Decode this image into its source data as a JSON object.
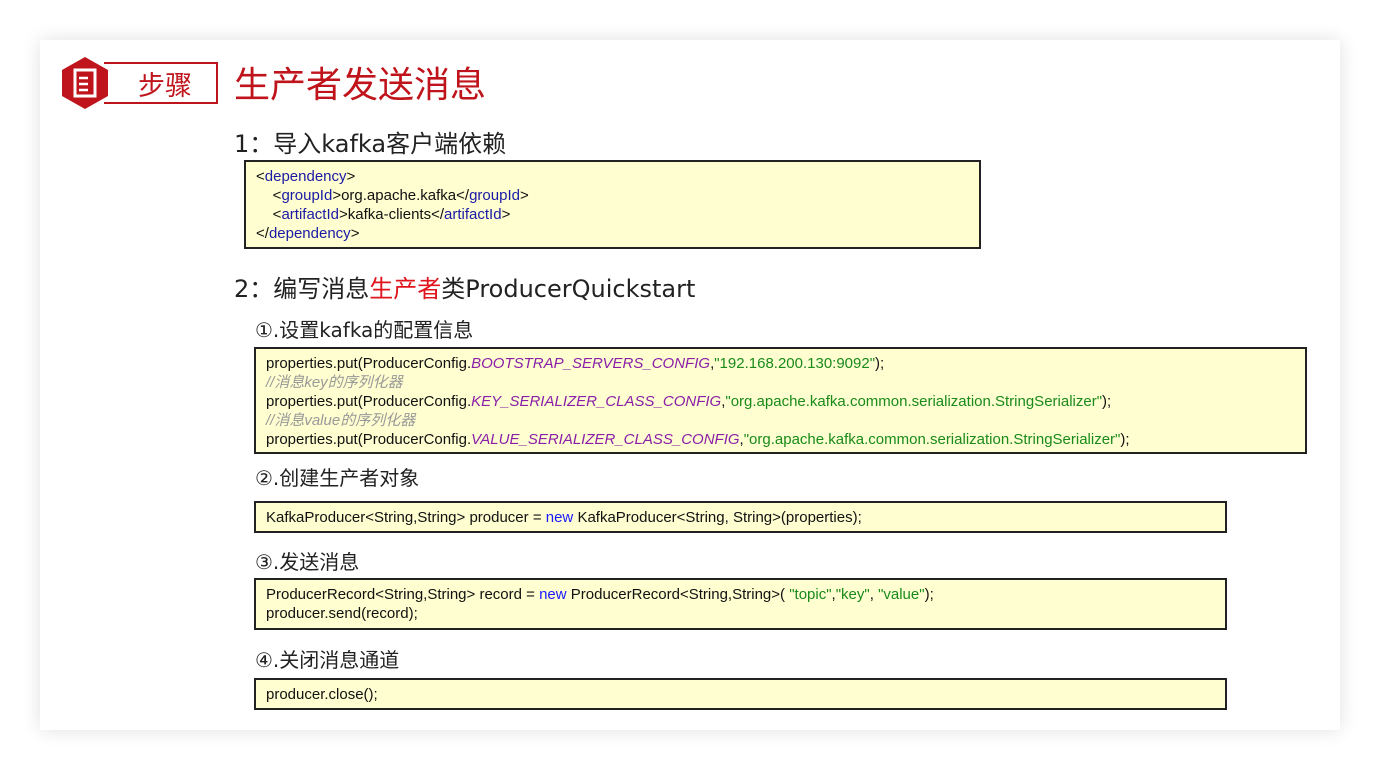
{
  "badge": {
    "label": "步骤",
    "icon": "document-icon",
    "color": "#c0141c"
  },
  "title": "生产者发送消息",
  "step1": {
    "heading": "1：导入kafka客户端依赖",
    "code": {
      "l1_open": "<",
      "l1_tag": "dependency",
      "l1_close": ">",
      "l2_indent": "    <",
      "l2_tag1": "groupId",
      "l2_mid": ">org.apache.kafka</",
      "l2_tag2": "groupId",
      "l2_close": ">",
      "l3_indent": "    <",
      "l3_tag1": "artifactId",
      "l3_mid": ">kafka-clients</",
      "l3_tag2": "artifactId",
      "l3_close": ">",
      "l4_open": "</",
      "l4_tag": "dependency",
      "l4_close": ">"
    }
  },
  "step2": {
    "heading_pre": "2：编写消息",
    "heading_red": "生产者",
    "heading_post": "类ProducerQuickstart"
  },
  "sub1": {
    "heading": "①.设置kafka的配置信息",
    "code": {
      "a_pre": "properties.put(ProducerConfig.",
      "a_const": "BOOTSTRAP_SERVERS_CONFIG",
      "a_mid": ",",
      "a_str": "\"192.168.200.130:9092\"",
      "a_end": ");",
      "b_cmt": "//消息key的序列化器",
      "c_pre": "properties.put(ProducerConfig.",
      "c_const": "KEY_SERIALIZER_CLASS_CONFIG",
      "c_mid": ",",
      "c_str": "\"org.apache.kafka.common.serialization.StringSerializer\"",
      "c_end": ");",
      "d_cmt": "//消息value的序列化器",
      "e_pre": "properties.put(ProducerConfig.",
      "e_const": "VALUE_SERIALIZER_CLASS_CONFIG",
      "e_mid": ",",
      "e_str": "\"org.apache.kafka.common.serialization.StringSerializer\"",
      "e_end": ");"
    }
  },
  "sub2": {
    "heading": "②.创建生产者对象",
    "code": {
      "pre": "KafkaProducer<String,String> producer = ",
      "kw": "new",
      "post": " KafkaProducer<String, String>(properties);"
    }
  },
  "sub3": {
    "heading": "③.发送消息",
    "code": {
      "pre": "ProducerRecord<String,String> record = ",
      "kw": "new",
      "mid": " ProducerRecord<String,String>( ",
      "s1": "\"topic\"",
      "c1": ",",
      "s2": "\"key\"",
      "c2": ", ",
      "s3": "\"value\"",
      "end": ");",
      "line2": "producer.send(record);"
    }
  },
  "sub4": {
    "heading": "④.关闭消息通道",
    "code": {
      "line": "producer.close();"
    }
  }
}
